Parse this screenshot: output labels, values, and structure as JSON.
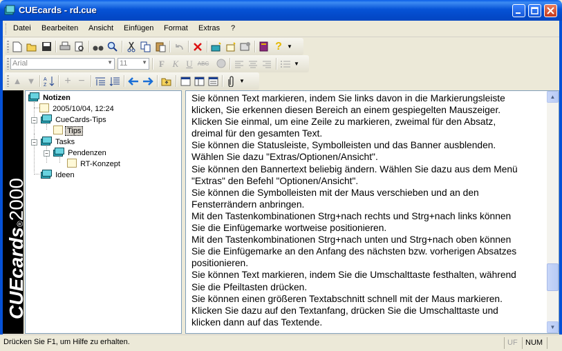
{
  "window": {
    "title": "CUEcards - rd.cue"
  },
  "menu": {
    "items": [
      "Datei",
      "Bearbeiten",
      "Ansicht",
      "Einfügen",
      "Format",
      "Extras",
      "?"
    ]
  },
  "format_bar": {
    "font_value": "Arial",
    "size_value": "11"
  },
  "banner": {
    "brand": "CUEcards",
    "registered": "®",
    "year": "2000"
  },
  "tree": {
    "root": "Notizen",
    "date_node": "2005/10/04, 12:24",
    "cuecards_tips": "CueCards-Tips",
    "tips": "Tips",
    "tasks": "Tasks",
    "pendenzen": "Pendenzen",
    "rt_konzept": "RT-Konzept",
    "ideen": "Ideen"
  },
  "editor": {
    "lines": [
      "Sie können Text markieren, indem Sie links davon in die Markierungsleiste",
      "klicken, Sie erkennen diesen Bereich an einem gespiegelten Mauszeiger.",
      "Klicken Sie einmal, um eine Zeile zu markieren, zweimal für den Absatz,",
      "dreimal für den gesamten Text.",
      "Sie können die Statusleiste, Symbolleisten und das Banner ausblenden.",
      "Wählen Sie dazu \"Extras/Optionen/Ansicht\".",
      "Sie können den Bannertext beliebig ändern. Wählen Sie dazu aus dem Menü",
      "\"Extras\" den Befehl \"Optionen/Ansicht\".",
      "Sie können die Symbolleisten mit der Maus verschieben und an den",
      "Fensterrändern anbringen.",
      "Mit den Tastenkombinationen Strg+nach rechts und Strg+nach links können",
      "Sie die Einfügemarke wortweise positionieren.",
      "Mit den Tastenkombinationen Strg+nach unten und Strg+nach oben können",
      "Sie die Einfügemarke an den Anfang des nächsten bzw. vorherigen Absatzes",
      "positionieren.",
      "Sie können Text markieren, indem Sie die Umschalttaste festhalten, während",
      "Sie die Pfeiltasten drücken.",
      "Sie können einen größeren Textabschnitt schnell mit der Maus markieren.",
      "Klicken Sie dazu auf den Textanfang, drücken Sie die Umschalttaste und",
      "klicken dann auf das Textende."
    ]
  },
  "status": {
    "hint": "Drücken Sie F1, um Hilfe zu erhalten.",
    "uf": "UF",
    "num": "NUM"
  }
}
